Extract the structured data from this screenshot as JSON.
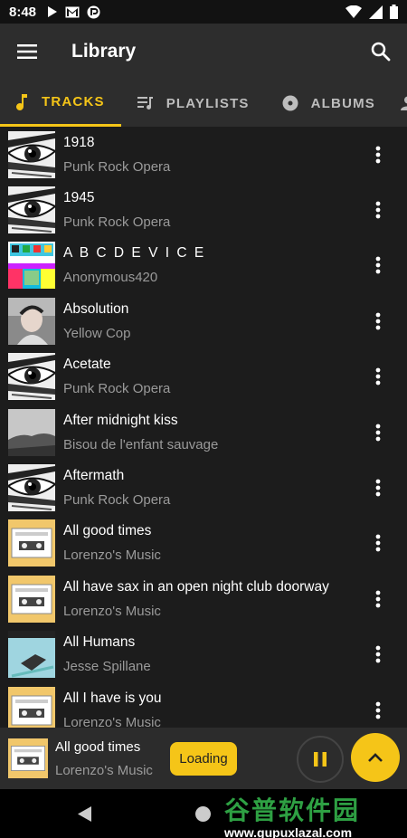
{
  "status": {
    "time": "8:48"
  },
  "appbar": {
    "title": "Library"
  },
  "tabs": [
    {
      "label": "TRACKS",
      "icon": "music-note-icon",
      "active": true
    },
    {
      "label": "PLAYLISTS",
      "icon": "playlist-icon",
      "active": false
    },
    {
      "label": "ALBUMS",
      "icon": "album-icon",
      "active": false
    }
  ],
  "tracks": [
    {
      "title": "1918",
      "artist": "Punk Rock Opera",
      "art": "eye"
    },
    {
      "title": "1945",
      "artist": "Punk Rock Opera",
      "art": "eye"
    },
    {
      "title": "A B C D E V I C E",
      "artist": "Anonymous420",
      "art": "colorful"
    },
    {
      "title": "Absolution",
      "artist": "Yellow Cop",
      "art": "portrait"
    },
    {
      "title": "Acetate",
      "artist": "Punk Rock Opera",
      "art": "eye"
    },
    {
      "title": "After midnight kiss",
      "artist": "Bisou de l'enfant sauvage",
      "art": "landscape"
    },
    {
      "title": "Aftermath",
      "artist": "Punk Rock Opera",
      "art": "eye"
    },
    {
      "title": "All good times",
      "artist": "Lorenzo's Music",
      "art": "cassette"
    },
    {
      "title": "All have sax in an open night club doorway",
      "artist": "Lorenzo's Music",
      "art": "cassette"
    },
    {
      "title": "All Humans",
      "artist": "Jesse Spillane",
      "art": "laundry"
    },
    {
      "title": "All I have is you",
      "artist": "Lorenzo's Music",
      "art": "cassette"
    }
  ],
  "player": {
    "title": "All good times",
    "artist": "Lorenzo's Music",
    "loading_label": "Loading"
  },
  "watermark": {
    "line1": "谷普软件园",
    "line2": "www.gupuxlazal.com"
  },
  "colors": {
    "accent": "#f5c518",
    "background": "#1c1c1c",
    "bar": "#2d2d2d"
  }
}
